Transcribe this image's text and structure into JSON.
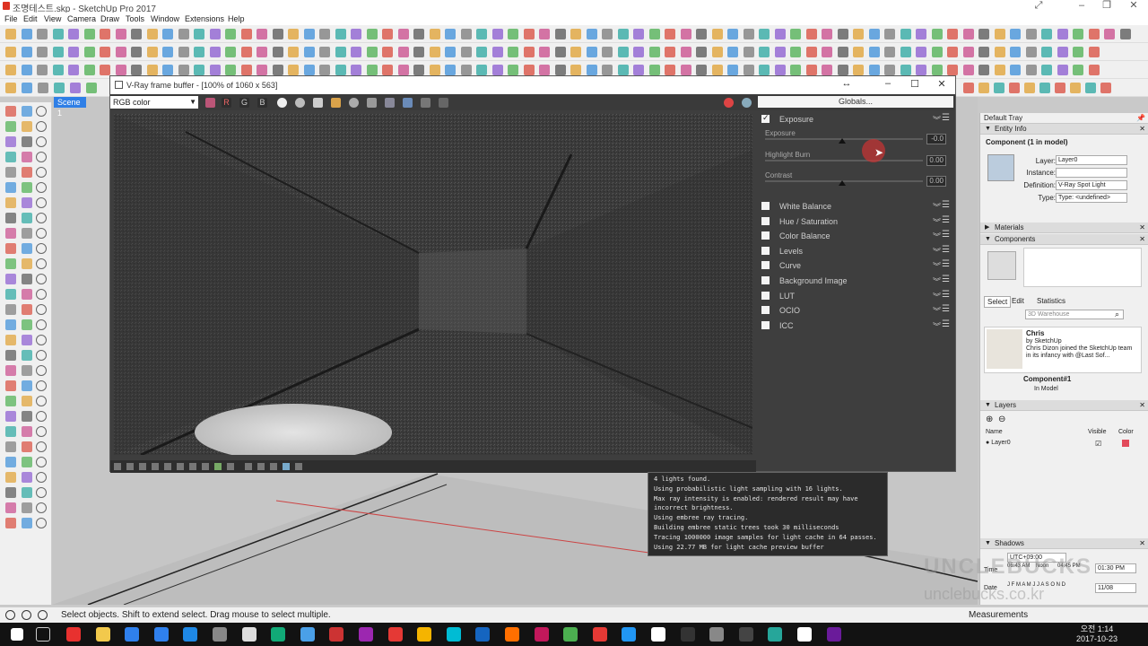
{
  "app": {
    "window_title": "조명테스트.skp - SketchUp Pro 2017",
    "menus": [
      "File",
      "Edit",
      "View",
      "Camera",
      "Draw",
      "Tools",
      "Window",
      "Extensions",
      "Help"
    ],
    "scene_tab": "Scene 1"
  },
  "vfb": {
    "title": "V-Ray frame buffer - [100% of 1060 x 563]",
    "channel": "RGB color",
    "channel_buttons": [
      "R",
      "G",
      "B"
    ],
    "globals_label": "Globals...",
    "exposure": {
      "header": "Exposure",
      "exposure_label": "Exposure",
      "exposure_value": "-0.0",
      "highlight_label": "Highlight Burn",
      "highlight_value": "0.00",
      "contrast_label": "Contrast",
      "contrast_value": "0.00"
    },
    "corrections": [
      "White Balance",
      "Hue / Saturation",
      "Color Balance",
      "Levels",
      "Curve",
      "Background Image",
      "LUT",
      "OCIO",
      "ICC"
    ]
  },
  "log": {
    "lines": [
      "4 lights found.",
      "Using probabilistic light sampling with 16 lights.",
      "Max ray intensity is enabled: rendered result may have",
      "incorrect brightness.",
      "Using embree ray tracing.",
      "Building embree static trees took 30 milliseconds",
      "Tracing 1000000 image samples for light cache in 64 passes.",
      "Using 22.77 MB for light cache preview buffer"
    ]
  },
  "tray": {
    "title": "Default Tray",
    "entity_info": {
      "header": "Entity Info",
      "selection": "Component (1 in model)",
      "layer_label": "Layer:",
      "layer_value": "Layer0",
      "instance_label": "Instance:",
      "definition_label": "Definition:",
      "definition_value": "V-Ray Spot Light",
      "type_label": "Type:",
      "type_value": "Type: <undefined>"
    },
    "materials_header": "Materials",
    "components": {
      "header": "Components",
      "tabs": [
        "Select",
        "Edit",
        "Statistics"
      ],
      "search_placeholder": "3D Warehouse",
      "item_name": "Chris",
      "item_by": "by SketchUp",
      "item_desc": "Chris Dizon joined the SketchUp team in its infancy with @Last Sof...",
      "current": "Component#1",
      "in_model": "In Model"
    },
    "layers": {
      "header": "Layers",
      "col_name": "Name",
      "col_visible": "Visible",
      "col_color": "Color",
      "row": "Layer0"
    },
    "shadows": {
      "header": "Shadows",
      "utc": "UTC+09:00",
      "time_label": "Time",
      "time_val": "06:43 AM",
      "noon": "Noon",
      "time_end": "04:45 PM",
      "time_field": "01:30 PM",
      "date_label": "Date",
      "date_months": "J F M A M J J A S O N D",
      "date_field": "11/08"
    }
  },
  "status": {
    "message": "Select objects. Shift to extend select. Drag mouse to select multiple.",
    "measurements": "Measurements"
  },
  "watermark": {
    "brand": "UNCLEBUCKS",
    "url": "unclebucks.co.kr"
  },
  "taskbar": {
    "time": "오전 1:14",
    "date": "2017-10-23"
  }
}
